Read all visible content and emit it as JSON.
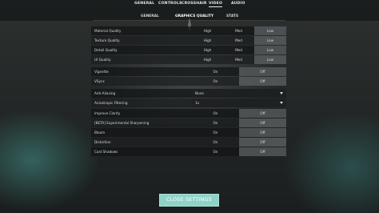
{
  "top_tabs": [
    "GENERAL",
    "CONTROLS",
    "CROSSHAIR",
    "VIDEO",
    "AUDIO"
  ],
  "active_top_tab": "VIDEO",
  "sub_tabs": [
    "GENERAL",
    "GRAPHICS QUALITY",
    "STATS"
  ],
  "active_sub_tab": "GRAPHICS QUALITY",
  "settings": [
    {
      "label": "Material Quality",
      "options": [
        "High",
        "Med",
        "Low"
      ],
      "selected": "Low"
    },
    {
      "label": "Texture Quality",
      "options": [
        "High",
        "Med",
        "Low"
      ],
      "selected": "Low"
    },
    {
      "label": "Detail Quality",
      "options": [
        "High",
        "Med",
        "Low"
      ],
      "selected": "Low"
    },
    {
      "label": "UI Quality",
      "options": [
        "High",
        "Med",
        "Low"
      ],
      "selected": "Low"
    },
    {
      "label": "Vignette",
      "options": [
        "On",
        "Off"
      ],
      "selected": "Off"
    },
    {
      "label": "VSync",
      "options": [
        "On",
        "Off"
      ],
      "selected": "Off"
    },
    {
      "label": "Anti-Aliasing",
      "dropdown": "None"
    },
    {
      "label": "Anisotropic Filtering",
      "dropdown": "1x"
    },
    {
      "label": "Improve Clarity",
      "options": [
        "On",
        "Off"
      ],
      "selected": "Off"
    },
    {
      "label": "[BETA] Experimental Sharpening",
      "options": [
        "On",
        "Off"
      ],
      "selected": "Off"
    },
    {
      "label": "Bloom",
      "options": [
        "On",
        "Off"
      ],
      "selected": "Off"
    },
    {
      "label": "Distortion",
      "options": [
        "On",
        "Off"
      ],
      "selected": "Off"
    },
    {
      "label": "Cast Shadows",
      "options": [
        "On",
        "Off"
      ],
      "selected": "Off"
    }
  ],
  "close_button_label": "CLOSE SETTINGS",
  "colors": {
    "accent": "#8fd3c8",
    "selected_option": "#787e80"
  }
}
